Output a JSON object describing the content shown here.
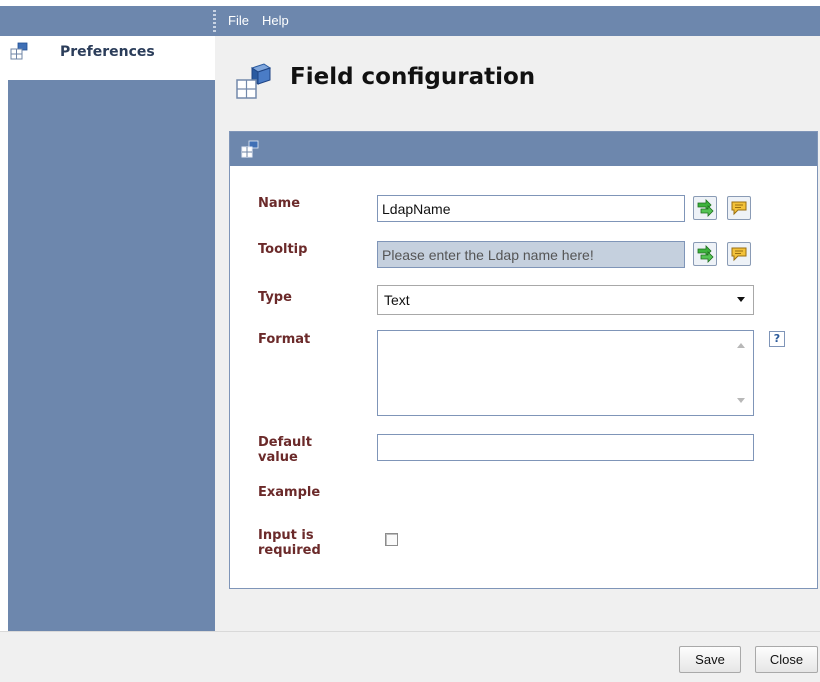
{
  "menubar": {
    "file_label": "File",
    "help_label": "Help"
  },
  "sidebar": {
    "items": [
      {
        "label": "Preferences",
        "icon": "preferences-icon"
      }
    ]
  },
  "page": {
    "title": "Field configuration",
    "icon": "field-config-icon"
  },
  "form": {
    "name": {
      "label": "Name",
      "value": "LdapName"
    },
    "tooltip": {
      "label": "Tooltip",
      "value": "Please enter the Ldap name here!"
    },
    "type": {
      "label": "Type",
      "value": "Text"
    },
    "format": {
      "label": "Format",
      "value": ""
    },
    "default_value": {
      "label_line1": "Default",
      "label_line2": "value",
      "value": ""
    },
    "example": {
      "label": "Example"
    },
    "input_required": {
      "label_line1": "Input is",
      "label_line2": "required",
      "checked": false
    },
    "help_glyph": "?"
  },
  "footer": {
    "save_label": "Save",
    "close_label": "Close"
  },
  "colors": {
    "chrome_blue": "#6d87ad",
    "label_maroon": "#6b2a2a",
    "tooltip_field_bg": "#c5d0de"
  }
}
